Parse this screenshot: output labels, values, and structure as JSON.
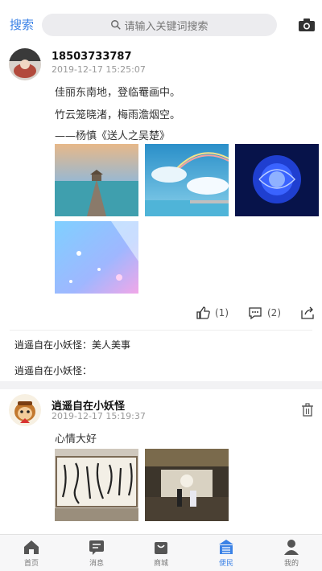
{
  "header": {
    "search_link": "搜索",
    "search_placeholder": "请输入关键词搜索"
  },
  "posts": [
    {
      "username": "18503733787",
      "time": "2019-12-17 15:25:07",
      "lines": [
        "佳丽东南地，登临罨画中。",
        "竹云笼晓渚，梅雨澹烟空。",
        "——杨慎《送人之吴楚》"
      ],
      "images": [
        "pier-sunset-image",
        "sky-rainbow-image",
        "blue-rose-image",
        "sparkle-light-image"
      ],
      "likes": "(1)",
      "comments_count": "(2)",
      "comments": [
        {
          "author": "逍遥自在小妖怪：",
          "text": "美人美事"
        },
        {
          "author": "逍遥自在小妖怪：",
          "text": ""
        }
      ]
    },
    {
      "username": "逍遥自在小妖怪",
      "time": "2019-12-17 15:19:37",
      "lines": [
        "心情大好"
      ],
      "images": [
        "calligraphy-image",
        "wedding-hall-image"
      ]
    }
  ],
  "tabs": [
    {
      "label": "首页",
      "icon": "home-icon"
    },
    {
      "label": "消息",
      "icon": "message-icon"
    },
    {
      "label": "商城",
      "icon": "shop-bag-icon"
    },
    {
      "label": "便民",
      "icon": "service-list-icon",
      "active": true
    },
    {
      "label": "我的",
      "icon": "user-icon"
    }
  ],
  "colors": {
    "accent": "#3b82e6",
    "background": "#ffffff",
    "divider": "#f2f2f4"
  }
}
